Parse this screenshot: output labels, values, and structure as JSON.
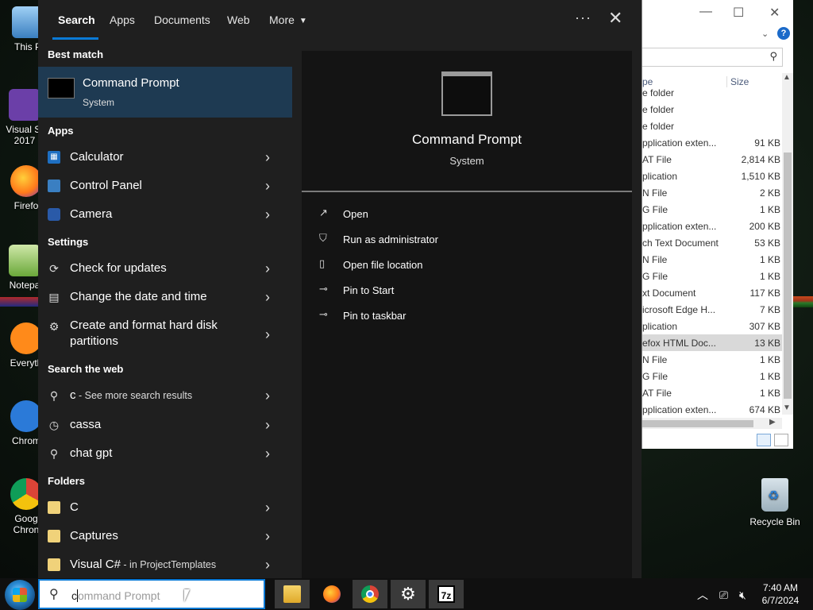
{
  "desktop": {
    "icons": [
      {
        "label": "This P",
        "glyph": "computer-icon"
      },
      {
        "label": "Visual St",
        "label2": "2017",
        "glyph": "visual-studio-icon"
      },
      {
        "label": "Firefo",
        "glyph": "firefox-icon"
      },
      {
        "label": "Notepa",
        "glyph": "notepad-icon"
      },
      {
        "label": "Everyth",
        "glyph": "everything-icon"
      },
      {
        "label": "Chrom",
        "glyph": "chrome-icon"
      },
      {
        "label": "Goog",
        "label2": "Chron",
        "glyph": "google-chrome-icon"
      }
    ],
    "recycle_bin": "Recycle Bin"
  },
  "explorer": {
    "header": {
      "type": "pe",
      "size": "Size"
    },
    "rows": [
      {
        "type": "e folder",
        "size": ""
      },
      {
        "type": "e folder",
        "size": ""
      },
      {
        "type": "e folder",
        "size": ""
      },
      {
        "type": "pplication exten...",
        "size": "91 KB"
      },
      {
        "type": "AT File",
        "size": "2,814 KB"
      },
      {
        "type": "plication",
        "size": "1,510 KB"
      },
      {
        "type": "N File",
        "size": "2 KB"
      },
      {
        "type": "G File",
        "size": "1 KB"
      },
      {
        "type": "pplication exten...",
        "size": "200 KB"
      },
      {
        "type": "ch Text Document",
        "size": "53 KB"
      },
      {
        "type": "N File",
        "size": "1 KB"
      },
      {
        "type": "G File",
        "size": "1 KB"
      },
      {
        "type": "xt Document",
        "size": "117 KB"
      },
      {
        "type": "icrosoft Edge H...",
        "size": "7 KB"
      },
      {
        "type": "plication",
        "size": "307 KB"
      },
      {
        "type": "efox HTML Doc...",
        "size": "13 KB",
        "selected": true
      },
      {
        "type": "N File",
        "size": "1 KB"
      },
      {
        "type": "G File",
        "size": "1 KB"
      },
      {
        "type": "AT File",
        "size": "1 KB"
      },
      {
        "type": "pplication exten...",
        "size": "674 KB"
      }
    ]
  },
  "search_panel": {
    "tabs": [
      {
        "label": "Search",
        "active": true
      },
      {
        "label": "Apps"
      },
      {
        "label": "Documents"
      },
      {
        "label": "Web"
      },
      {
        "label": "More"
      }
    ],
    "more_icon": "ellipsis-icon",
    "close_icon": "close-icon",
    "sections": {
      "best_match": "Best match",
      "apps": "Apps",
      "settings": "Settings",
      "web": "Search the web",
      "folders": "Folders"
    },
    "best_match": {
      "name": "Command Prompt",
      "sub": "System"
    },
    "apps": [
      {
        "label": "Calculator",
        "icon": "calculator-icon"
      },
      {
        "label": "Control Panel",
        "icon": "control-panel-icon"
      },
      {
        "label": "Camera",
        "icon": "camera-icon"
      }
    ],
    "settings": [
      {
        "label": "Check for updates",
        "icon": "refresh-icon"
      },
      {
        "label": "Change the date and time",
        "icon": "calendar-icon"
      },
      {
        "label": "Create and format hard disk partitions",
        "icon": "gear-icon"
      }
    ],
    "web": [
      {
        "label": "c",
        "suffix": " - See more search results",
        "icon": "search-icon"
      },
      {
        "label": "cassa",
        "icon": "history-icon"
      },
      {
        "label": "chat gpt",
        "icon": "search-icon"
      }
    ],
    "folders": [
      {
        "label": "C",
        "suffix": ""
      },
      {
        "label": "Captures",
        "suffix": ""
      },
      {
        "label": "Visual C#",
        "suffix": " - in ProjectTemplates"
      }
    ],
    "preview": {
      "title": "Command Prompt",
      "subtitle": "System",
      "actions": [
        {
          "label": "Open",
          "icon": "open-icon"
        },
        {
          "label": "Run as administrator",
          "icon": "shield-icon"
        },
        {
          "label": "Open file location",
          "icon": "file-location-icon"
        },
        {
          "label": "Pin to Start",
          "icon": "pin-icon"
        },
        {
          "label": "Pin to taskbar",
          "icon": "pin-icon"
        }
      ]
    }
  },
  "taskbar": {
    "search_typed": "c",
    "search_ghost": "ommand Prompt",
    "apps": [
      {
        "name": "file-explorer",
        "active": true
      },
      {
        "name": "firefox",
        "active": false
      },
      {
        "name": "chrome",
        "active": true
      },
      {
        "name": "settings",
        "active": false
      },
      {
        "name": "7zip",
        "active": false
      }
    ],
    "clock_time": "7:40 AM",
    "clock_date": "6/7/2024"
  },
  "colors": {
    "accent": "#0a7ad6",
    "panel_bg": "#1f1f1f",
    "selected_bg": "#1e3a52"
  }
}
